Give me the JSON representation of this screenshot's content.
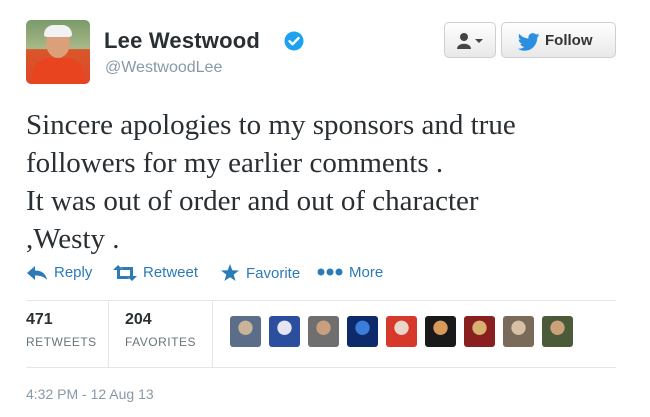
{
  "user": {
    "display_name": "Lee Westwood",
    "handle": "@WestwoodLee",
    "verified": true
  },
  "buttons": {
    "user_actions_icon": "person-dropdown-icon",
    "follow_label": "Follow"
  },
  "tweet": {
    "text": "Sincere apologies to my sponsors and true\nfollowers for my earlier comments .\nIt was out of order and out of character\n,Westy ."
  },
  "actions": {
    "reply": "Reply",
    "retweet": "Retweet",
    "favorite": "Favorite",
    "more": "More"
  },
  "stats": {
    "retweets_count": "471",
    "retweets_label": "RETWEETS",
    "favorites_count": "204",
    "favorites_label": "FAVORITES"
  },
  "favoriters": [
    {
      "colors": [
        "#5a6e8a",
        "#c9b49a"
      ]
    },
    {
      "colors": [
        "#2b4f9e",
        "#e6e6f2"
      ]
    },
    {
      "colors": [
        "#6f6f6f",
        "#c8a080"
      ]
    },
    {
      "colors": [
        "#0d2a6b",
        "#3b7dd8"
      ]
    },
    {
      "colors": [
        "#d6382a",
        "#e9d6c8"
      ]
    },
    {
      "colors": [
        "#1a1a1a",
        "#d89a5a"
      ]
    },
    {
      "colors": [
        "#8a1f1f",
        "#d8b070"
      ]
    },
    {
      "colors": [
        "#7a6a5a",
        "#d7c0a5"
      ]
    },
    {
      "colors": [
        "#4b5b3a",
        "#c9a27a"
      ]
    }
  ],
  "timestamp": "4:32 PM - 12 Aug 13",
  "colors": {
    "link": "#2b7bb9",
    "verified": "#1da1f2",
    "twitter_bird": "#2b8fe0"
  }
}
